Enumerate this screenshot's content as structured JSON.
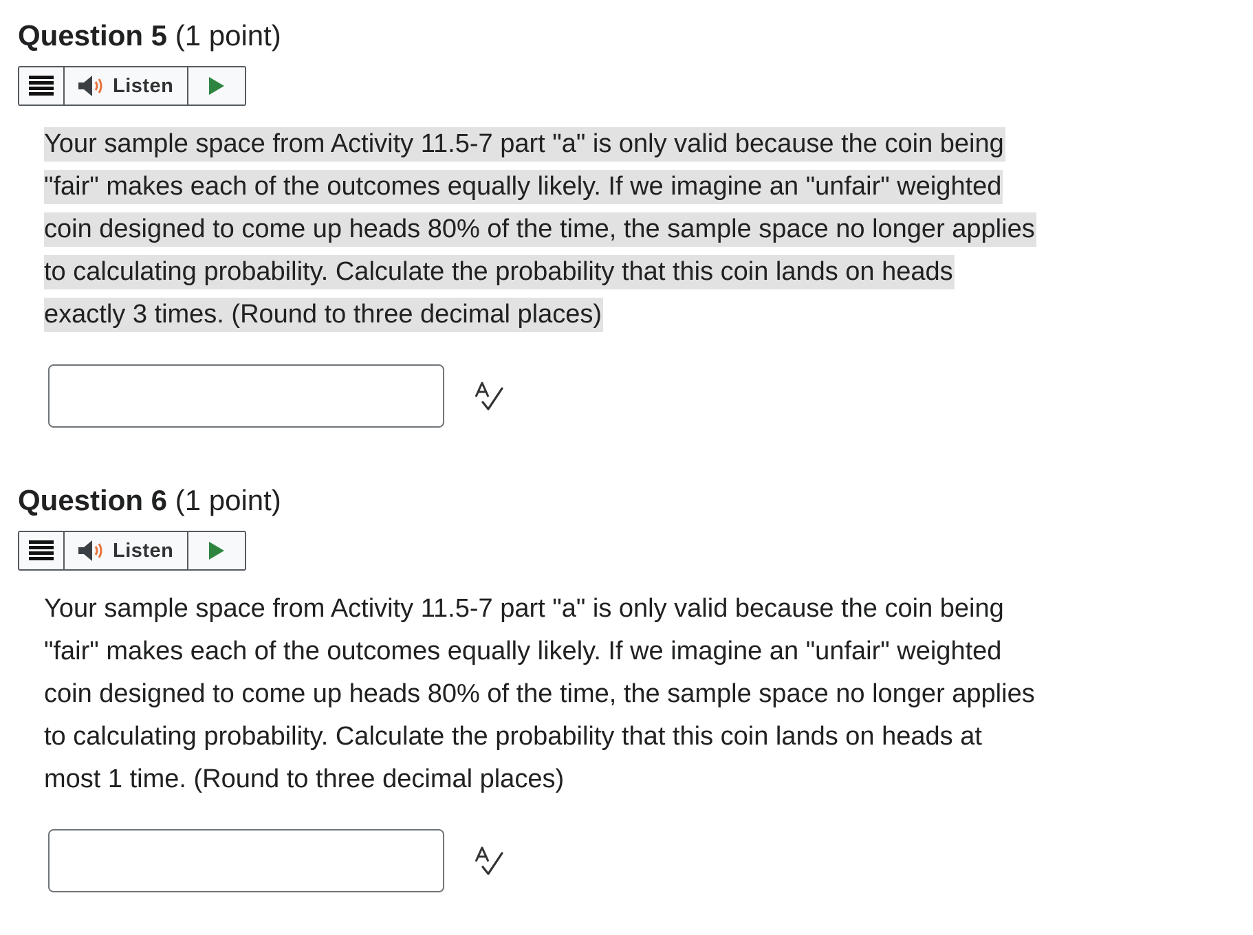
{
  "questions": [
    {
      "title": "Question 5",
      "points": "(1 point)",
      "listen_label": "Listen",
      "prompt_lines": [
        "Your sample space from Activity 11.5-7 part \"a\" is only valid because the coin being",
        "\"fair\" makes each of the outcomes equally likely. If we imagine an \"unfair\" weighted",
        "coin designed to come up heads 80% of the time, the sample space no longer applies",
        "to calculating probability. Calculate the probability that this coin lands on heads",
        "exactly 3 times. (Round to three decimal places)"
      ],
      "answer_value": ""
    },
    {
      "title": "Question 6",
      "points": "(1 point)",
      "listen_label": "Listen",
      "prompt_lines": [
        "Your sample space from Activity 11.5-7 part \"a\" is only valid because the coin being",
        "\"fair\" makes each of the outcomes equally likely. If we imagine an \"unfair\" weighted",
        "coin designed to come up heads 80% of the time, the sample space no longer applies",
        "to calculating probability. Calculate the probability that this coin lands on heads at",
        "most 1 time. (Round to three decimal places)"
      ],
      "answer_value": ""
    }
  ],
  "icons": {
    "menu": "menu-icon",
    "speaker": "speaker-icon",
    "play": "play-icon",
    "spell_check": "spell-check-icon"
  },
  "colors": {
    "text": "#202122",
    "highlight": "#e2e2e2",
    "play_green": "#2e8540",
    "speaker_accent": "#e8733a",
    "toolbar_border": "#555a5f",
    "input_border": "#6f7478"
  }
}
